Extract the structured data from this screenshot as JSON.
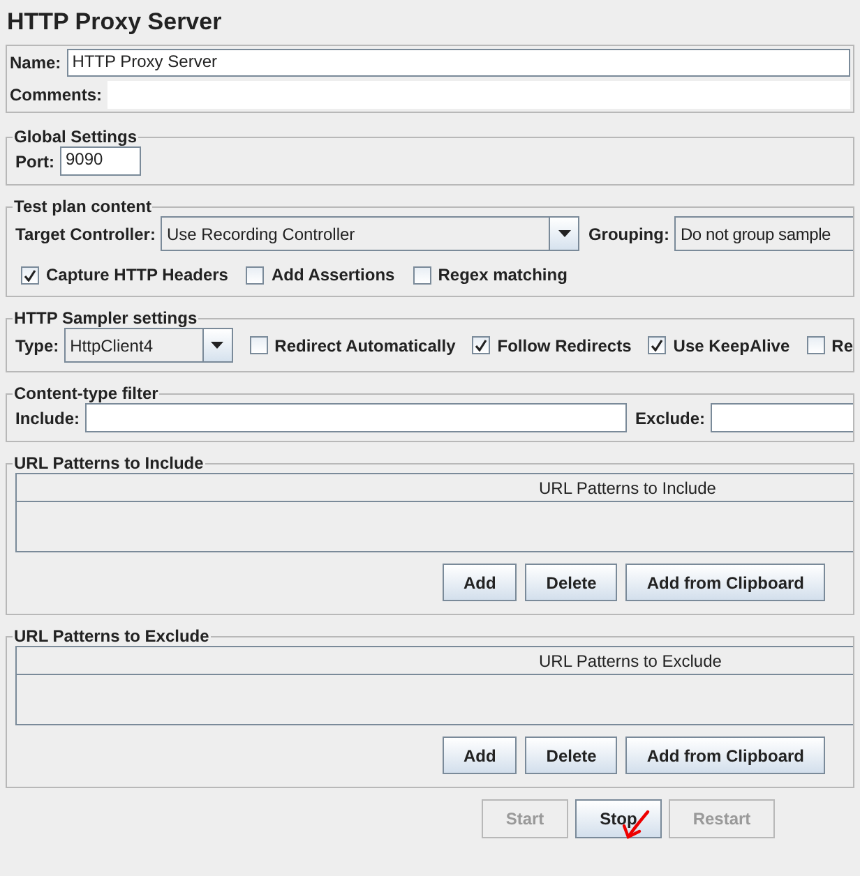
{
  "title": "HTTP Proxy Server",
  "name_field": {
    "label": "Name:",
    "value": "HTTP Proxy Server"
  },
  "comments_field": {
    "label": "Comments:"
  },
  "global_settings": {
    "title": "Global Settings",
    "port_label": "Port:",
    "port_value": "9090"
  },
  "test_plan_content": {
    "title": "Test plan content",
    "target_label": "Target Controller:",
    "target_value": "Use Recording Controller",
    "grouping_label": "Grouping:",
    "grouping_value": "Do not group sample",
    "options": [
      {
        "label": "Capture HTTP Headers",
        "checked": true
      },
      {
        "label": "Add Assertions",
        "checked": false
      },
      {
        "label": "Regex matching",
        "checked": false
      }
    ]
  },
  "http_sampler_settings": {
    "title": "HTTP Sampler settings",
    "type_label": "Type:",
    "type_value": "HttpClient4",
    "options": [
      {
        "label": "Redirect Automatically",
        "checked": false
      },
      {
        "label": "Follow Redirects",
        "checked": true
      },
      {
        "label": "Use KeepAlive",
        "checked": true
      },
      {
        "label": "Re",
        "checked": false
      }
    ]
  },
  "content_type_filter": {
    "title": "Content-type filter",
    "include_label": "Include:",
    "exclude_label": "Exclude:"
  },
  "url_include": {
    "title": "URL Patterns to Include",
    "column": "URL Patterns to Include",
    "buttons": [
      "Add",
      "Delete",
      "Add from Clipboard"
    ]
  },
  "url_exclude": {
    "title": "URL Patterns to Exclude",
    "column": "URL Patterns to Exclude",
    "buttons": [
      "Add",
      "Delete",
      "Add from Clipboard"
    ]
  },
  "controls": [
    {
      "label": "Start",
      "disabled": true
    },
    {
      "label": "Stop",
      "disabled": false
    },
    {
      "label": "Restart",
      "disabled": true
    }
  ],
  "annotation": {
    "kind": "arrow"
  }
}
